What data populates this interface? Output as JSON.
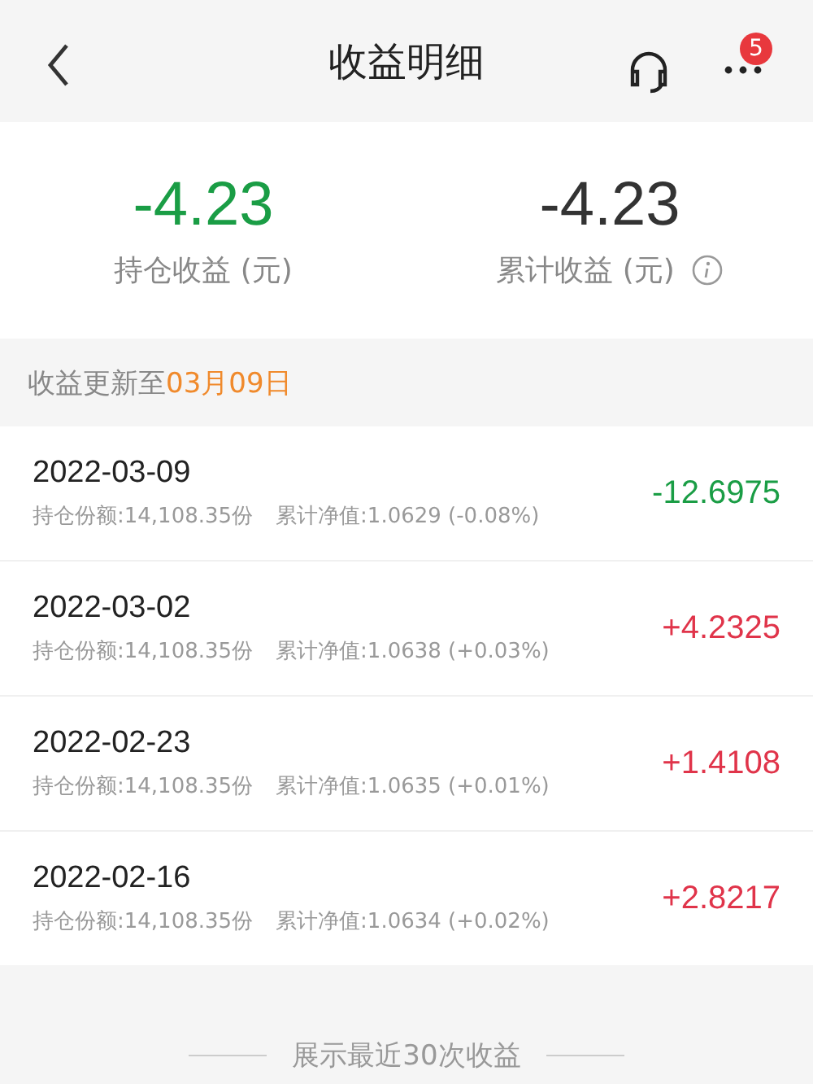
{
  "header": {
    "title": "收益明细",
    "badge": "5"
  },
  "summary": [
    {
      "value": "-4.23",
      "label": "持仓收益 (元)",
      "kind": "loss",
      "info": false
    },
    {
      "value": "-4.23",
      "label": "累计收益 (元)",
      "kind": "neutral",
      "info": true
    }
  ],
  "update": {
    "prefix": "收益更新至",
    "date": "03月09日"
  },
  "rows": [
    {
      "date": "2022-03-09",
      "holding": "持仓份额:14,108.35份",
      "nav": "累计净值:1.0629 (-0.08%)",
      "amount": "-12.6975",
      "kind": "loss"
    },
    {
      "date": "2022-03-02",
      "holding": "持仓份额:14,108.35份",
      "nav": "累计净值:1.0638 (+0.03%)",
      "amount": "+4.2325",
      "kind": "gain"
    },
    {
      "date": "2022-02-23",
      "holding": "持仓份额:14,108.35份",
      "nav": "累计净值:1.0635 (+0.01%)",
      "amount": "+1.4108",
      "kind": "gain"
    },
    {
      "date": "2022-02-16",
      "holding": "持仓份额:14,108.35份",
      "nav": "累计净值:1.0634 (+0.02%)",
      "amount": "+2.8217",
      "kind": "gain"
    }
  ],
  "footer": "展示最近30次收益"
}
